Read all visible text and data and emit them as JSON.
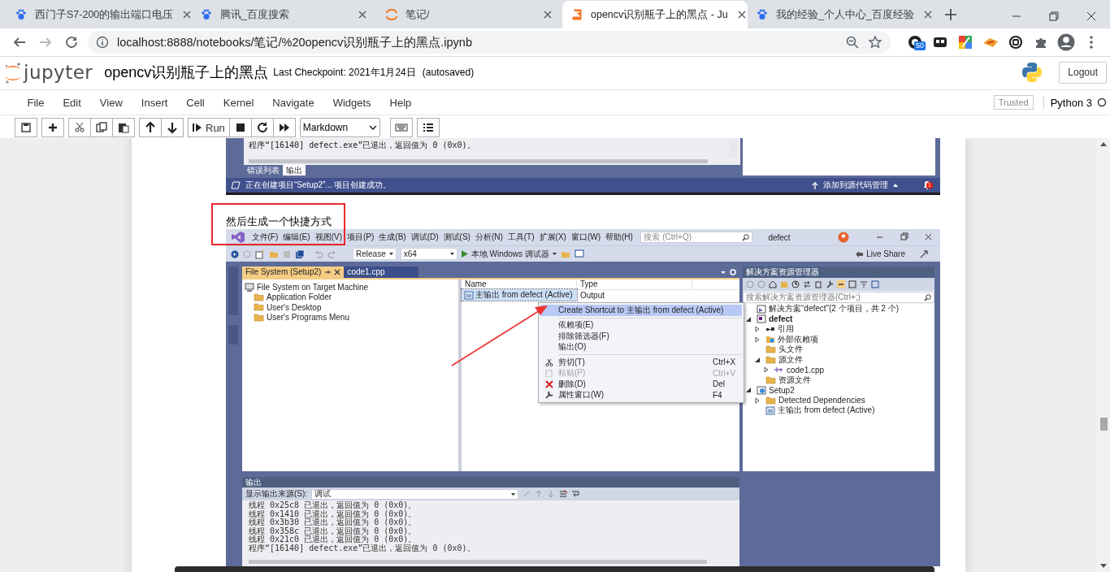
{
  "browser": {
    "tabs": [
      {
        "title": "西门子S7-200的输出端口电压",
        "kind": "baidu",
        "selected": false
      },
      {
        "title": "腾讯_百度搜索",
        "kind": "baidu",
        "selected": false
      },
      {
        "title": "笔记/",
        "kind": "jupyter",
        "selected": false
      },
      {
        "title": "opencv识别瓶子上的黑点 - Ju",
        "kind": "notebook",
        "selected": true
      },
      {
        "title": "我的经验_个人中心_百度经验",
        "kind": "baidu",
        "selected": false
      }
    ],
    "url": "localhost:8888/notebooks/笔记/%20opencv识别瓶子上的黑点.ipynb",
    "extension_badge": "50"
  },
  "jupyter": {
    "logo_text": "jupyter",
    "title": "opencv识别瓶子上的黑点",
    "checkpoint": "Last Checkpoint: 2021年1月24日",
    "autosave_status": "(autosaved)",
    "logout": "Logout",
    "menu": [
      "File",
      "Edit",
      "View",
      "Insert",
      "Cell",
      "Kernel",
      "Navigate",
      "Widgets",
      "Help"
    ],
    "trusted": "Trusted",
    "kernel": "Python 3",
    "run": "Run",
    "cell_type": "Markdown"
  },
  "notebook": {
    "output_fragment": {
      "line": "程序“[16140] defect.exe”已退出，返回值为 0 (0x0)。",
      "tabs": [
        {
          "label": "错误列表",
          "selected": false
        },
        {
          "label": "输出",
          "selected": true
        }
      ],
      "status_text": "正在创建项目“Setup2”... 项目创建成功。",
      "status_right": "添加到源代码管理",
      "notification_count": "1"
    },
    "markdown": "然后生成一个快捷方式",
    "vs_window": {
      "menu": [
        "文件(F)",
        "编辑(E)",
        "视图(V)",
        "项目(P)",
        "生成(B)",
        "调试(D)",
        "测试(S)",
        "分析(N)",
        "工具(T)",
        "扩展(X)",
        "窗口(W)",
        "帮助(H)"
      ],
      "search_placeholder": "搜索 (Ctrl+Q)",
      "solution_name": "defect",
      "configuration": "Release",
      "platform": "x64",
      "debugger": "本地 Windows 调试器",
      "live_share": "Live Share",
      "doc_tabs": [
        {
          "label": "File System (Setup2)",
          "selected": true
        },
        {
          "label": "code1.cpp",
          "selected": false
        }
      ],
      "file_system_tree": [
        {
          "label": "File System on Target Machine",
          "kind": "machine",
          "children": [
            {
              "label": "Application Folder",
              "kind": "folder"
            },
            {
              "label": "User's Desktop",
              "kind": "folder"
            },
            {
              "label": "User's Programs Menu",
              "kind": "folder"
            }
          ]
        }
      ],
      "columns": [
        "Name",
        "Type"
      ],
      "rows": [
        {
          "name": "主输出 from defect (Active)",
          "type": "Output",
          "selected": true
        }
      ],
      "context_menu": [
        {
          "kind": "plain",
          "label": "Create Shortcut to 主输出 from defect (Active)",
          "selected": true,
          "disabled": false
        },
        {
          "kind": "separator"
        },
        {
          "kind": "plain",
          "label": "依赖项(E)",
          "selected": false,
          "disabled": false
        },
        {
          "kind": "plain",
          "label": "排除筛选器(F)",
          "selected": false,
          "disabled": false
        },
        {
          "kind": "plain",
          "label": "输出(O)",
          "selected": false,
          "disabled": false
        },
        {
          "kind": "separator"
        },
        {
          "kind": "cut",
          "label": "剪切(T)",
          "shortcut": "Ctrl+X",
          "selected": false,
          "disabled": false
        },
        {
          "kind": "paste",
          "label": "粘贴(P)",
          "shortcut": "Ctrl+V",
          "selected": false,
          "disabled": true
        },
        {
          "kind": "delete",
          "label": "删除(D)",
          "shortcut": "Del",
          "selected": false,
          "disabled": false
        },
        {
          "kind": "properties",
          "label": "属性窗口(W)",
          "shortcut": "F4",
          "selected": false,
          "disabled": false
        }
      ],
      "solution_explorer": {
        "title": "解决方案资源管理器",
        "search_placeholder": "搜索解决方案资源管理器(Ctrl+;)",
        "tree": [
          {
            "label": "解决方案“defect”(2 个项目，共 2 个)",
            "kind": "solution"
          },
          {
            "label": "defect",
            "kind": "project",
            "startup_project": true,
            "expanded": true,
            "children": [
              {
                "label": "引用",
                "kind": "references",
                "expanded": false
              },
              {
                "label": "外部依赖项",
                "kind": "external",
                "expanded": false
              },
              {
                "label": "头文件",
                "kind": "folder"
              },
              {
                "label": "源文件",
                "kind": "folder",
                "expanded": true,
                "children": [
                  {
                    "label": "code1.cpp",
                    "kind": "cppfile",
                    "expanded": false
                  }
                ]
              },
              {
                "label": "资源文件",
                "kind": "folder"
              }
            ]
          },
          {
            "label": "Setup2",
            "kind": "setup",
            "startup_project": false,
            "expanded": true,
            "children": [
              {
                "label": "Detected Dependencies",
                "kind": "folder",
                "expanded": false
              },
              {
                "label": "主输出 from defect (Active)",
                "kind": "output"
              }
            ]
          }
        ]
      },
      "output": {
        "title": "输出",
        "source_label": "显示输出来源(S):",
        "source": "调试",
        "lines": [
          "线程 0x25c8 已退出，返回值为 0 (0x0)。",
          "线程 0x1410 已退出，返回值为 0 (0x0)。",
          "线程 0x3b30 已退出，返回值为 0 (0x0)。",
          "线程 0x358c 已退出，返回值为 0 (0x0)。",
          "线程 0x21c0 已退出，返回值为 0 (0x0)。",
          "程序“[16140] defect.exe”已退出，返回值为 0 (0x0)。"
        ]
      }
    }
  }
}
